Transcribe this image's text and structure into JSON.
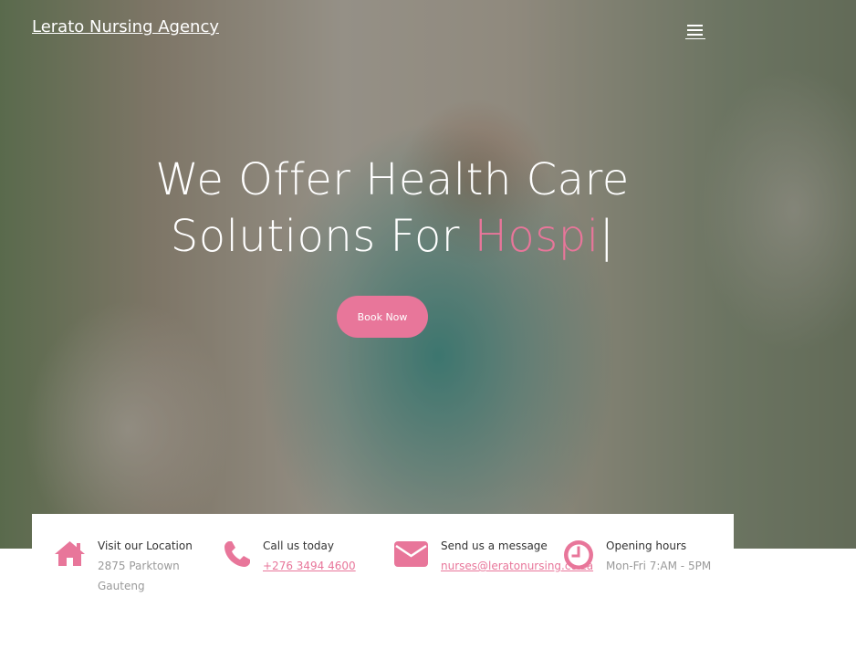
{
  "brand": {
    "name": "Lerato Nursing Agency"
  },
  "nav": {
    "menu_icon": "hamburger-icon"
  },
  "hero": {
    "line1": "We Offer Health Care",
    "line2_prefix": "Solutions For ",
    "line2_typed": "Hospi",
    "cursor": "|",
    "cta_label": "Book Now"
  },
  "info": {
    "location": {
      "icon": "home-icon",
      "title": "Visit our Location",
      "line1": "2875 Parktown",
      "line2": "Gauteng"
    },
    "phone": {
      "icon": "phone-icon",
      "title": "Call us today",
      "value": "+276 3494 4600"
    },
    "email": {
      "icon": "envelope-icon",
      "title": "Send us a message",
      "value": "nurses@leratonursing.co.za"
    },
    "hours": {
      "icon": "clock-icon",
      "title": "Opening hours",
      "value": "Mon-Fri 7:AM - 5PM"
    }
  },
  "colors": {
    "accent": "#e8769a",
    "text_dark": "#333333",
    "text_muted": "#9a9a9a"
  }
}
